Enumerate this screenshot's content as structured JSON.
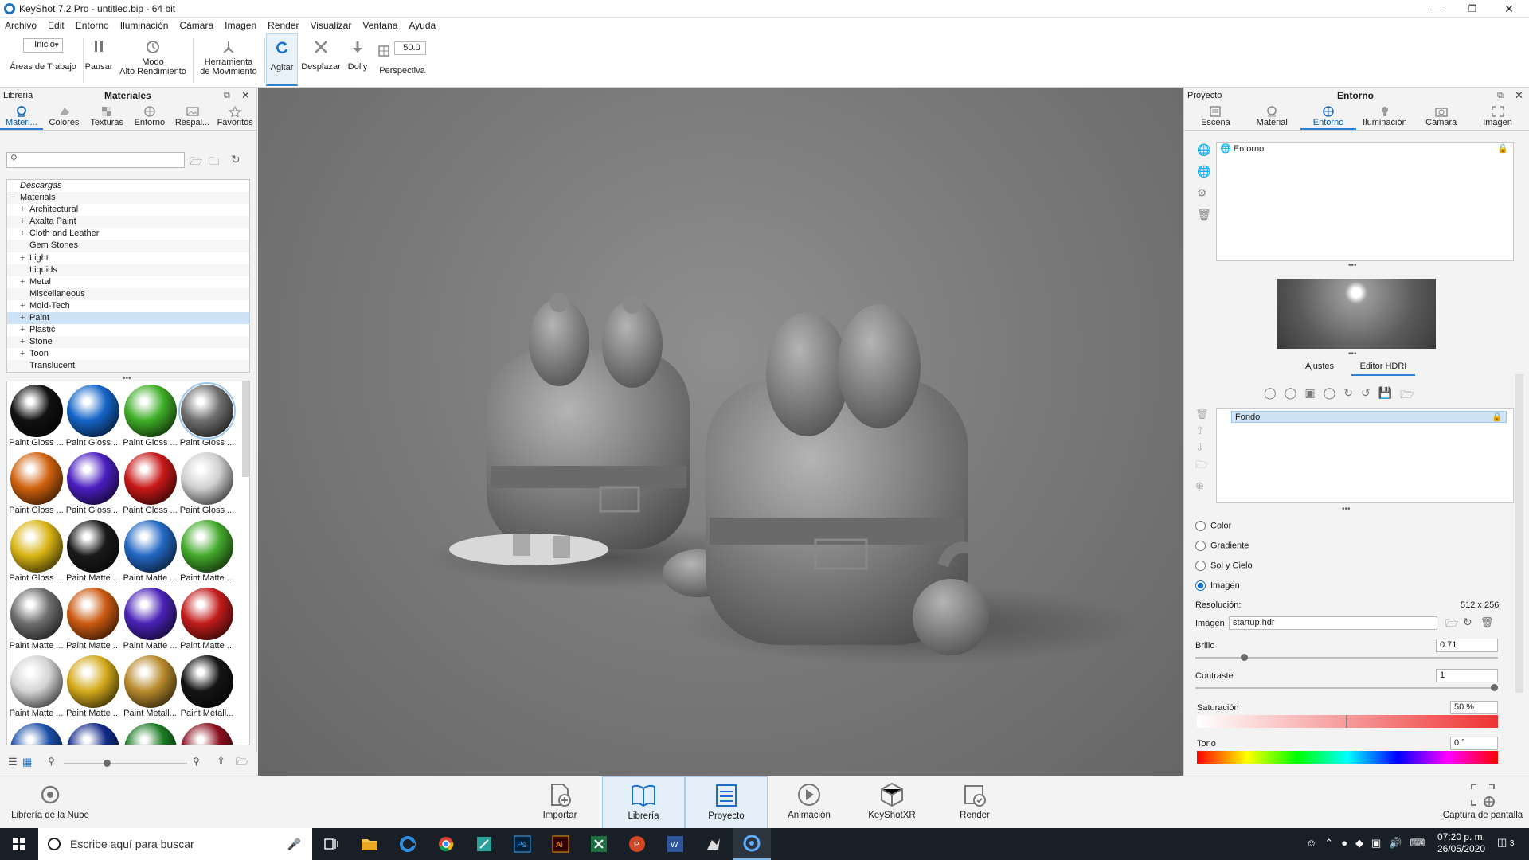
{
  "window": {
    "title": "KeyShot 7.2 Pro  - untitled.bip  - 64 bit"
  },
  "menu": [
    "Archivo",
    "Edit",
    "Entorno",
    "Iluminación",
    "Cámara",
    "Imagen",
    "Render",
    "Visualizar",
    "Ventana",
    "Ayuda"
  ],
  "toolbar": {
    "workspace_select": "Inicio",
    "workspace_label": "Áreas de Trabajo",
    "pause": "Pausar",
    "perf_line1": "Modo",
    "perf_line2": "Alto Rendimiento",
    "motion_line1": "Herramienta",
    "motion_line2": "de Movimiento",
    "tumble": "Agitar",
    "pan": "Desplazar",
    "dolly": "Dolly",
    "fov_value": "50.0",
    "perspective": "Perspectiva"
  },
  "left_panel": {
    "header_left": "Librería",
    "header_title": "Materiales",
    "tabs": [
      "Materi...",
      "Colores",
      "Texturas",
      "Entorno",
      "Respal...",
      "Favoritos"
    ],
    "search_placeholder": "",
    "tree": [
      {
        "label": "Descargas",
        "indent": 0,
        "expander": ""
      },
      {
        "label": "Materials",
        "indent": 0,
        "expander": "−"
      },
      {
        "label": "Architectural",
        "indent": 1,
        "expander": "+"
      },
      {
        "label": "Axalta Paint",
        "indent": 1,
        "expander": "+"
      },
      {
        "label": "Cloth and Leather",
        "indent": 1,
        "expander": "+"
      },
      {
        "label": "Gem Stones",
        "indent": 1,
        "expander": ""
      },
      {
        "label": "Light",
        "indent": 1,
        "expander": "+"
      },
      {
        "label": "Liquids",
        "indent": 1,
        "expander": ""
      },
      {
        "label": "Metal",
        "indent": 1,
        "expander": "+"
      },
      {
        "label": "Miscellaneous",
        "indent": 1,
        "expander": ""
      },
      {
        "label": "Mold-Tech",
        "indent": 1,
        "expander": "+"
      },
      {
        "label": "Paint",
        "indent": 1,
        "expander": "+",
        "selected": true
      },
      {
        "label": "Plastic",
        "indent": 1,
        "expander": "+"
      },
      {
        "label": "Stone",
        "indent": 1,
        "expander": "+"
      },
      {
        "label": "Toon",
        "indent": 1,
        "expander": "+"
      },
      {
        "label": "Translucent",
        "indent": 1,
        "expander": ""
      }
    ],
    "swatches": [
      {
        "name": "Paint Gloss ...",
        "color": "#111111"
      },
      {
        "name": "Paint Gloss ...",
        "color": "#1565c8"
      },
      {
        "name": "Paint Gloss ...",
        "color": "#3fae28"
      },
      {
        "name": "Paint Gloss ...",
        "color": "#707070",
        "selected": true
      },
      {
        "name": "Paint Gloss ...",
        "color": "#d0620e"
      },
      {
        "name": "Paint Gloss ...",
        "color": "#4a1ec0"
      },
      {
        "name": "Paint Gloss ...",
        "color": "#c81818"
      },
      {
        "name": "Paint Gloss ...",
        "color": "#cfcfcf"
      },
      {
        "name": "Paint Gloss ...",
        "color": "#d8b414"
      },
      {
        "name": "Paint Matte ...",
        "color": "#1a1a1a"
      },
      {
        "name": "Paint Matte ...",
        "color": "#2468c4"
      },
      {
        "name": "Paint Matte ...",
        "color": "#44aa2c"
      },
      {
        "name": "Paint Matte ...",
        "color": "#6e6e6e"
      },
      {
        "name": "Paint Matte ...",
        "color": "#cc5a12"
      },
      {
        "name": "Paint Matte ...",
        "color": "#4a22b6"
      },
      {
        "name": "Paint Matte ...",
        "color": "#c21c1c"
      },
      {
        "name": "Paint Matte ...",
        "color": "#d4d4d4"
      },
      {
        "name": "Paint Matte ...",
        "color": "#d4aa1c"
      },
      {
        "name": "Paint Metall...",
        "color": "#b88a2c"
      },
      {
        "name": "Paint Metall...",
        "color": "#141414"
      },
      {
        "name": "",
        "color": "#1b4fa8"
      },
      {
        "name": "",
        "color": "#122a8a"
      },
      {
        "name": "",
        "color": "#1b7a24"
      },
      {
        "name": "",
        "color": "#8a0e1e"
      }
    ]
  },
  "right_panel": {
    "header_left": "Proyecto",
    "header_title": "Entorno",
    "tabs": [
      "Escena",
      "Material",
      "Entorno",
      "Iluminación",
      "Cámara",
      "Imagen"
    ],
    "env_item": "Entorno",
    "subtabs": [
      "Ajustes",
      "Editor HDRI"
    ],
    "layer_item": "Fondo",
    "radio_options": [
      "Color",
      "Gradiente",
      "Sol y Cielo",
      "Imagen"
    ],
    "resolution_label": "Resolución:",
    "resolution_value": "512 x 256",
    "image_label": "Imagen",
    "image_value": "startup.hdr",
    "brightness_label": "Brillo",
    "brightness_value": "0.71",
    "contrast_label": "Contraste",
    "contrast_value": "1",
    "saturation_label": "Saturación",
    "saturation_value": "50 %",
    "hue_label": "Tono",
    "hue_value": "0 °"
  },
  "bottom_bar": {
    "cloud": "Librería de la Nube",
    "import": "Importar",
    "library": "Librería",
    "project": "Proyecto",
    "animation": "Animación",
    "xr": "KeyShotXR",
    "render": "Render",
    "screenshot": "Captura de pantalla"
  },
  "taskbar": {
    "search_placeholder": "Escribe aquí para buscar",
    "time": "07:20 p. m.",
    "date": "26/05/2020",
    "notifications": "3"
  }
}
